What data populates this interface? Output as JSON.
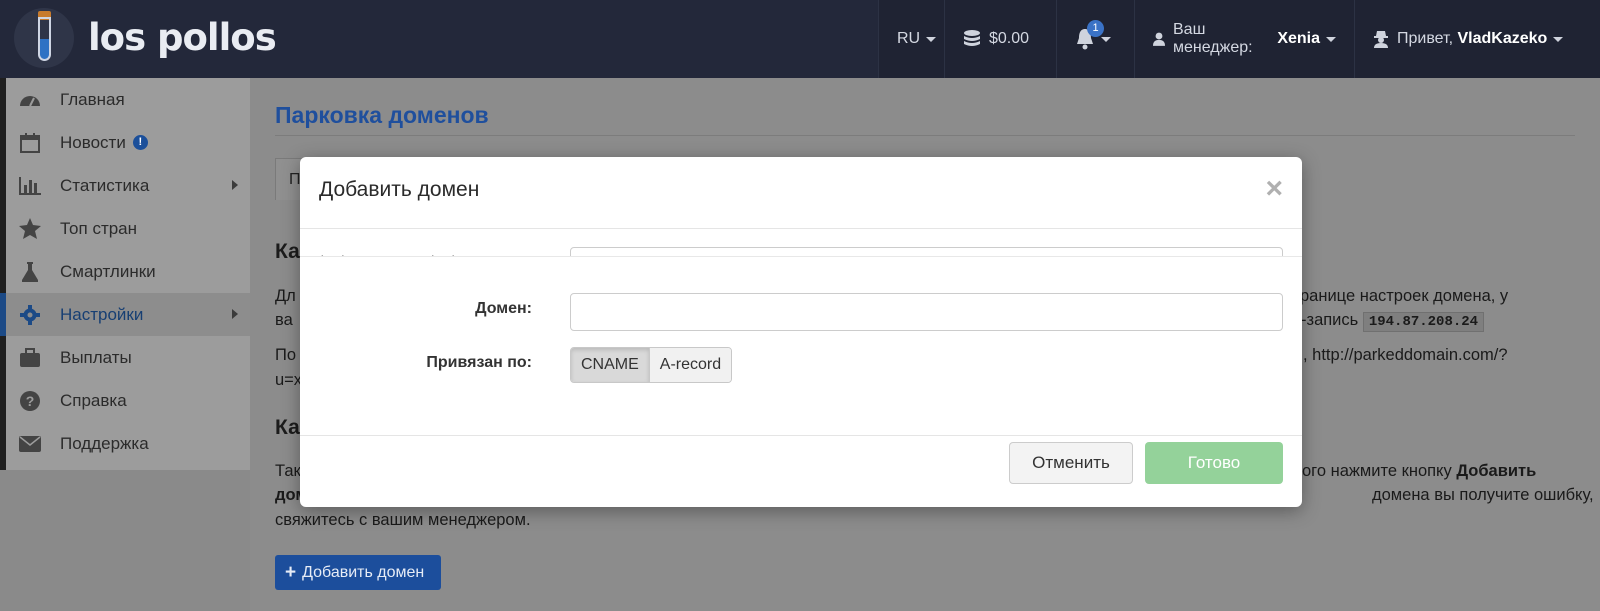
{
  "header": {
    "brand": "los pollos",
    "language": "RU",
    "balance": "$0.00",
    "notifications_count": "1",
    "manager_label": "Ваш менеджер:",
    "manager_name": "Xenia",
    "greeting": "Привет,",
    "username": "VladKazeko"
  },
  "sidebar": {
    "items": [
      {
        "label": "Главная",
        "icon": "dashboard-icon"
      },
      {
        "label": "Новости",
        "icon": "calendar-icon",
        "info_badge": "!"
      },
      {
        "label": "Статистика",
        "icon": "bar-chart-icon"
      },
      {
        "label": "Топ стран",
        "icon": "star-icon"
      },
      {
        "label": "Смартлинки",
        "icon": "flask-icon"
      },
      {
        "label": "Настройки",
        "icon": "gear-icon"
      },
      {
        "label": "Выплаты",
        "icon": "briefcase-icon"
      },
      {
        "label": "Справка",
        "icon": "question-icon"
      },
      {
        "label": "Поддержка",
        "icon": "envelope-icon"
      }
    ]
  },
  "main": {
    "page_title": "Парковка доменов",
    "tab_stub": "П",
    "section1_heading": "Ка",
    "para1_line1_left": "Дл",
    "para1_line1_right": "ранице настроек домена, у",
    "para1_line2_left": "ва",
    "para1_line2_right": "А-запись",
    "ip_code": "194.87.208.24",
    "para2_line1_left": "По",
    "para2_line1_right": "http://parkeddomain.com/?",
    "para2_line2_left": "u=x",
    "section2_heading": "Ка",
    "para3_line1_left": "Так",
    "para3_line1_right": "ого нажмите кнопку",
    "para3_line1_bold": "Добавить",
    "para3_line2_left": "доме",
    "para3_line2_right": "домена вы получите ошибку,",
    "para3_line3": "свяжитесь с вашим менеджером.",
    "add_button": "Добавить домен"
  },
  "modal": {
    "title": "Добавить домен",
    "close_glyph": "×",
    "domain_label": "Домен:",
    "domain_value": "",
    "bound_label": "Привязан по:",
    "options": [
      "CNAME",
      "A-record"
    ],
    "selected_option": "CNAME",
    "cancel_label": "Отменить",
    "done_label": "Готово"
  },
  "colors": {
    "topbar": "#23283a",
    "accent_blue": "#1f4f9d",
    "done_button": "#94d29a"
  }
}
